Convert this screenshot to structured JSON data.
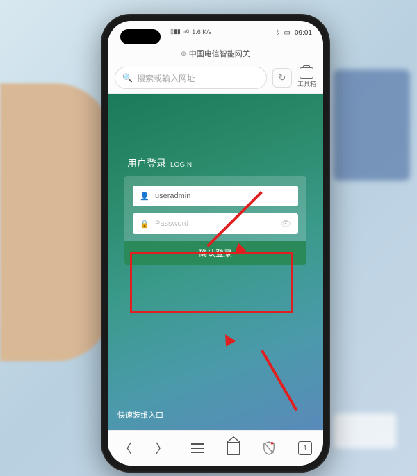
{
  "status": {
    "signal_text": "⁴ᴳ",
    "net_speed": "1.6 K/s",
    "battery_icon": "▭",
    "time": "09:01"
  },
  "address_bar": {
    "title": "中国电信智能网关"
  },
  "search": {
    "placeholder": "搜索或输入网址"
  },
  "toolbox": {
    "label": "工具箱"
  },
  "login": {
    "title_cn": "用户登录",
    "title_en": "LOGIN",
    "username_value": "useradmin",
    "password_placeholder": "Password",
    "submit_label": "确认登录"
  },
  "quick_link": {
    "label": "快速装维入口"
  },
  "nav": {
    "tab_count": "1"
  },
  "annotation": {
    "dot_color": "#e02020"
  }
}
